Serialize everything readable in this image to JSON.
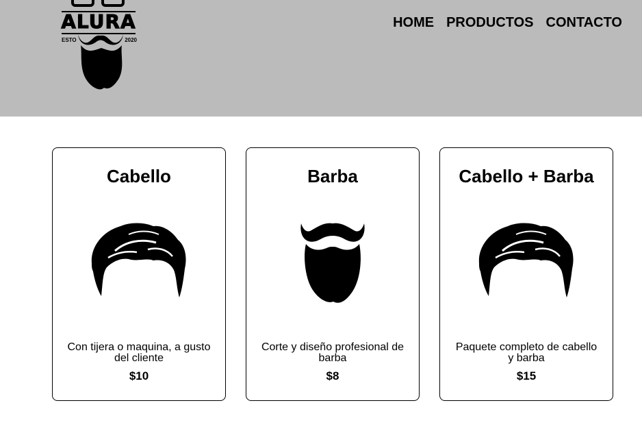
{
  "brand": {
    "name": "ALURA",
    "est_label": "ESTO",
    "year": "2020"
  },
  "nav": [
    {
      "label": "HOME"
    },
    {
      "label": "PRODUCTOS"
    },
    {
      "label": "CONTACTO"
    }
  ],
  "products": [
    {
      "title": "Cabello",
      "image": "hair-icon",
      "description": "Con tijera o maquina, a gusto del cliente",
      "price": "$10"
    },
    {
      "title": "Barba",
      "image": "beard-icon",
      "description": "Corte y diseño profesional de barba",
      "price": "$8"
    },
    {
      "title": "Cabello + Barba",
      "image": "hair-icon",
      "description": "Paquete completo de cabello y barba",
      "price": "$15"
    }
  ],
  "colors": {
    "header_bg": "#bbbbbb",
    "text": "#000000",
    "card_border": "#000000"
  }
}
